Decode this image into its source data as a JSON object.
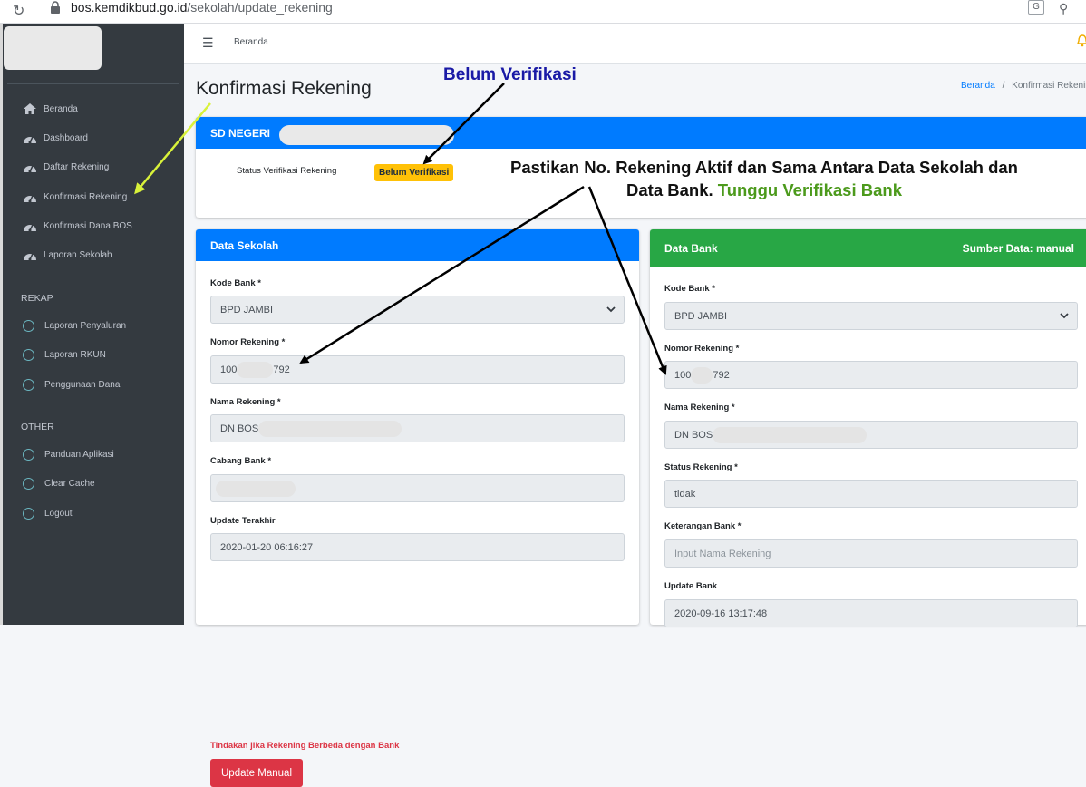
{
  "browser": {
    "url_domain": "bos.kemdikbud.go.id",
    "url_path": "/sekolah/update_rekening"
  },
  "sidebar": {
    "main_items": [
      {
        "label": "Beranda",
        "icon": "home-icon"
      },
      {
        "label": "Dashboard",
        "icon": "tachometer-icon"
      },
      {
        "label": "Daftar Rekening",
        "icon": "tachometer-icon"
      },
      {
        "label": "Konfirmasi Rekening",
        "icon": "tachometer-icon"
      },
      {
        "label": "Konfirmasi Dana BOS",
        "icon": "tachometer-icon"
      },
      {
        "label": "Laporan Sekolah",
        "icon": "tachometer-icon"
      }
    ],
    "rekap_header": "REKAP",
    "rekap_items": [
      {
        "label": "Laporan Penyaluran",
        "icon": "circle-icon"
      },
      {
        "label": "Laporan RKUN",
        "icon": "circle-icon"
      },
      {
        "label": "Penggunaan Dana",
        "icon": "circle-icon"
      }
    ],
    "other_header": "OTHER",
    "other_items": [
      {
        "label": "Panduan Aplikasi",
        "icon": "circle-icon"
      },
      {
        "label": "Clear Cache",
        "icon": "circle-icon"
      },
      {
        "label": "Logout",
        "icon": "circle-icon"
      }
    ]
  },
  "topnav": {
    "home": "Beranda"
  },
  "page": {
    "title": "Konfirmasi Rekening",
    "breadcrumb_home": "Beranda",
    "breadcrumb_sep": "/",
    "breadcrumb_current": "Konfirmasi Rekenin"
  },
  "school": {
    "name_prefix": "SD NEGERI",
    "status_label": "Status Verifikasi Rekening",
    "status_badge": "Belum Verifikasi",
    "badge_color": "#ffc107"
  },
  "data_sekolah": {
    "title": "Data Sekolah",
    "kode_bank_label": "Kode Bank *",
    "kode_bank_value": "BPD JAMBI",
    "nomor_label": "Nomor Rekening *",
    "nomor_start": "100",
    "nomor_end": "792",
    "nama_label": "Nama Rekening *",
    "nama_value": "DN BOS",
    "cabang_label": "Cabang Bank *",
    "update_label": "Update Terakhir",
    "update_value": "2020-01-20 06:16:27",
    "diff_label": "Tindakan jika Rekening Berbeda dengan Bank",
    "button_label": "Update Manual"
  },
  "data_bank": {
    "title": "Data Bank",
    "source": "Sumber Data: manual",
    "kode_bank_label": "Kode Bank *",
    "kode_bank_value": "BPD JAMBI",
    "nomor_label": "Nomor Rekening *",
    "nomor_start": "100",
    "nomor_end": "792",
    "nama_label": "Nama Rekening *",
    "nama_value": "DN BOS",
    "status_label": "Status Rekening *",
    "status_value": "tidak",
    "keterangan_label": "Keterangan Bank *",
    "keterangan_placeholder": "Input Nama Rekening",
    "update_label": "Update Bank",
    "update_value": "2020-09-16 13:17:48"
  },
  "annotations": {
    "belum": "Belum Verifikasi",
    "main_line1": "Pastikan No. Rekening Aktif dan Sama Antara Data Sekolah dan",
    "main_line2": "Data Bank.",
    "main_green": "Tunggu Verifikasi Bank"
  },
  "colors": {
    "primary": "#007bff",
    "success": "#28a745",
    "danger": "#dc3545",
    "sidebar": "#343a40"
  }
}
